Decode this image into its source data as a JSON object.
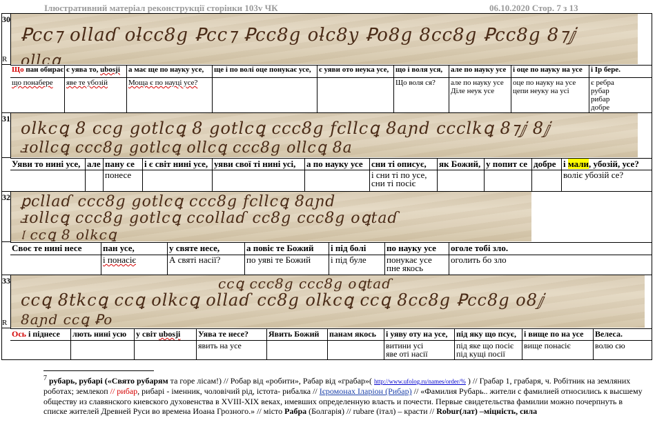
{
  "header": {
    "title": "Ілюстративний матеріал  реконструкції сторінки 103v ЧК",
    "date_page": "06.10.2020  Стор. 7 з 13"
  },
  "rows": [
    {
      "number": "30",
      "marker": "R",
      "manuscript": [
        "Ꝑcc⁊ ollaɗ oƚcc8g Ꝑcc⁊ Ꝑcc8g oƚc8y Ꝑo8g 8cc8g Ꝑcc8g 8⁊ⅉ",
        "ollcꝗ"
      ],
      "labels_lead": "Що",
      "labels_lead_rest": " пан обирає",
      "labels": [
        "є уява то, ",
        "ubosji",
        "а має ще по науку усе,",
        "ще і по волі оце понукає усе,",
        "є уяви ото неука усе,",
        "що і воля уся,",
        "але по науку усе",
        "і оце по науку на усе",
        "і Ір бере."
      ],
      "trans": [
        "що понабере",
        "яве те убозій",
        "Моща є по науці усе?",
        "",
        "",
        "Що воля ся?",
        "але по науку усе | Діле неук усе",
        "оце по науку на усе | цепи неуку на усі",
        "є ребра | рубар | рибар | добре"
      ]
    },
    {
      "number": "31",
      "marker": "",
      "manuscript": [
        "olkcꝗ 8 ccg gotlcꝗ 8 gotlcꝗ ccc8g fcllcꝗ 8aɲd ccclkꝗ 8⁊ⅉ 8ⅉ",
        "ⅎollcꝗ ccc8g gotlcꝗ ollcꝗ ccc8g ollcꝗ 8a"
      ],
      "labels": [
        "Уяви то нині усе,",
        "але",
        "пану се",
        "і є світ нині усе,",
        "уяви свої ті  нині усі,",
        "а по науку усе",
        "сни ті описує,",
        "як Божий,",
        "у попит се",
        "добре",
        "і ",
        "мали",
        ", убозій, усе?"
      ],
      "trans": [
        "",
        "",
        "понесе",
        "",
        "",
        "",
        "і сни ті по усе, | сни ті посіє",
        "",
        "",
        "",
        "",
        "волі",
        "є убозій се?"
      ]
    },
    {
      "number": "32",
      "marker": "",
      "manuscript": [
        "ꝑcllaɗ ccc8g gotlcꝗ ccc8g fcllcꝗ 8aɲd",
        "ⅎollcꝗ ccc8g gotlcꝗ ccollaɗ cc8g ccc8g oꝗtaɗ",
        "𝔩 ccꝗ 8 olkcꝗ"
      ],
      "labels": [
        "Своє те нині несе",
        "пан усе,",
        "у святе несе,",
        "а повіє те Божий",
        "і під болі",
        "по науку усе",
        "оголе тобі зло."
      ],
      "trans": [
        "",
        "і понасіє",
        "А святі насії?",
        "по уяві те Божий",
        "і під буле",
        "понукає усе | пне якось",
        "оголить бо зло"
      ]
    },
    {
      "number": "33",
      "marker": "R",
      "manuscript": [
        "ccꝗ ccc8g ccc8g oꝗtaɗ",
        "ccꝗ 8tkcꝗ ccꝗ olkcꝗ ollaɗ cc8g olkcꝗ ccꝗ 8cc8g Ꝑcc8g o8ⅉ",
        "8aɲd ccꝗ Ꝑo"
      ],
      "labels_lead": "Ось",
      "labels_lead_rest": " і піднесе",
      "labels": [
        "лють нині усю",
        "у світ ",
        "ubosji",
        "Уява те несе?",
        "Явить Божий",
        "панам якось",
        "і уяву оту на усе,",
        "під яку що псує,",
        "і вище по на усе",
        "Велеса."
      ],
      "trans": [
        "",
        "",
        "",
        "явить на усе",
        "",
        "",
        "витини усі | яве оті насії",
        "під яке що посіє | під кущі посії",
        "вище понасіє",
        "волю сю"
      ]
    }
  ],
  "footnote": {
    "num": "7",
    "term": "рубарь, рубарі",
    "open_q": " («Свято ",
    "term2": "рубарям",
    "rest1": " та горе лісам!) // Робар від «робити», Рабар від «грабар»( ",
    "url": "http://www.ufolog.ru/names/order/%",
    "rest2": " ) // Грабар 1, грабаря, ч. Робітник на земляних роботах; землекоп ",
    "red_part": "// рибар",
    "rest3": ", рибарі - іменник, чоловічий рід, істота-  рибалка // ",
    "blue_part": "Ієромонах Іларіон (Рибар)",
    "rest4": " // «Фамилия Рубарь.. жители с фамилией относились к высшему обществу из славянского киевского духовенства в XVIII-XIX веках, имевших определенную власть и почести. Первые свидетельства фамилии можно почерпнуть в списке жителей Древней Руси во времена Иоана Грозного.» // місто ",
    "term3": "Рабра",
    "rest5": " (Болгарія) //  rubare (італ) – красти // ",
    "term4": "Robur",
    "rest6": "(лат) –міцність, сила"
  }
}
